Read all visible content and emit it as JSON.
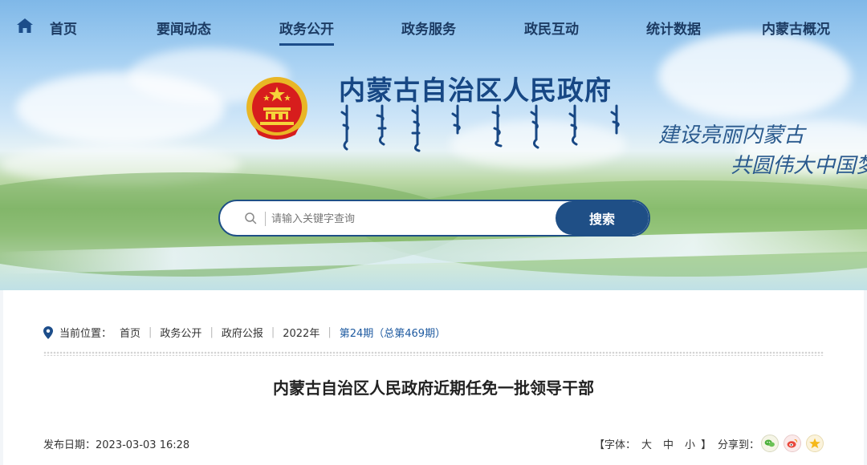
{
  "nav": {
    "items": [
      {
        "label": "首页",
        "active": false
      },
      {
        "label": "要闻动态",
        "active": false
      },
      {
        "label": "政务公开",
        "active": true
      },
      {
        "label": "政务服务",
        "active": false
      },
      {
        "label": "政民互动",
        "active": false
      },
      {
        "label": "统计数据",
        "active": false
      },
      {
        "label": "内蒙古概况",
        "active": false
      }
    ]
  },
  "header": {
    "site_title": "内蒙古自治区人民政府",
    "slogan_line1": "建设亮丽内蒙古",
    "slogan_line2": "共圆伟大中国梦"
  },
  "search": {
    "placeholder": "请输入关键字查询",
    "button_label": "搜索"
  },
  "breadcrumb": {
    "prefix": "当前位置：",
    "items": [
      "首页",
      "政务公开",
      "政府公报",
      "2022年",
      "第24期（总第469期）"
    ]
  },
  "article": {
    "title": "内蒙古自治区人民政府近期任免一批领导干部",
    "pubdate_label": "发布日期：",
    "pubdate": "2023-03-03 16:28",
    "fontsize_open": "【字体：",
    "fontsize_large": "大",
    "fontsize_medium": "中",
    "fontsize_small": "小",
    "fontsize_close": "】",
    "share_label": "分享到："
  },
  "colors": {
    "brand": "#1f4f86",
    "title": "#174784",
    "current_breadcrumb": "#1e5aa0"
  }
}
